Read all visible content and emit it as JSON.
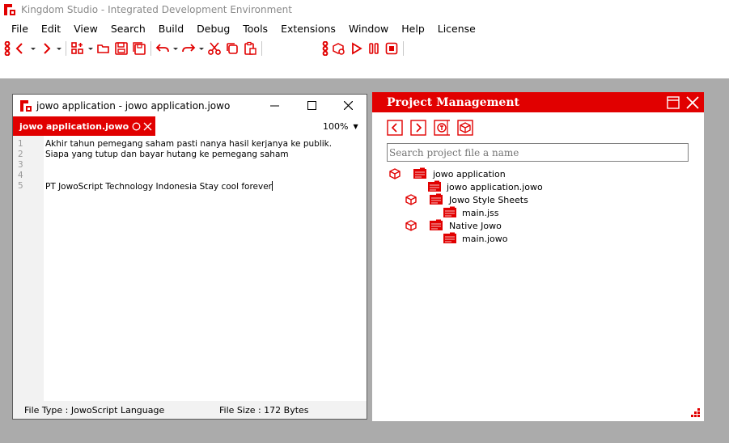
{
  "app": {
    "title": "Kingdom Studio - Integrated Development Environment"
  },
  "menu": [
    "File",
    "Edit",
    "View",
    "Search",
    "Build",
    "Debug",
    "Tools",
    "Extensions",
    "Window",
    "Help",
    "License"
  ],
  "editor": {
    "window_title": "jowo application - jowo application.jowo",
    "tab_label": "jowo application.jowo",
    "zoom": "100%",
    "lines": [
      {
        "num": "1",
        "text": "Akhir tahun pemegang saham pasti nanya hasil kerjanya ke publik."
      },
      {
        "num": "2",
        "text": "Siapa yang tutup dan bayar hutang ke pemegang saham"
      },
      {
        "num": "3",
        "text": ""
      },
      {
        "num": "4",
        "text": ""
      },
      {
        "num": "5",
        "text": "PT JowoScript Technology Indonesia Stay cool forever"
      }
    ],
    "status_file_type": "File Type : JowoScript Language",
    "status_file_size": "File Size :  172 Bytes"
  },
  "project": {
    "title": "Project Management",
    "search_placeholder": "Search project file a name",
    "tree": [
      {
        "label": "jowo application"
      },
      {
        "label": "jowo application.jowo"
      },
      {
        "label": "Jowo Style Sheets"
      },
      {
        "label": "main.jss"
      },
      {
        "label": "Native Jowo"
      },
      {
        "label": "main.jowo"
      }
    ]
  },
  "colors": {
    "accent": "#e10000",
    "workspace": "#ababab",
    "gutter": "#f2f2f2"
  }
}
